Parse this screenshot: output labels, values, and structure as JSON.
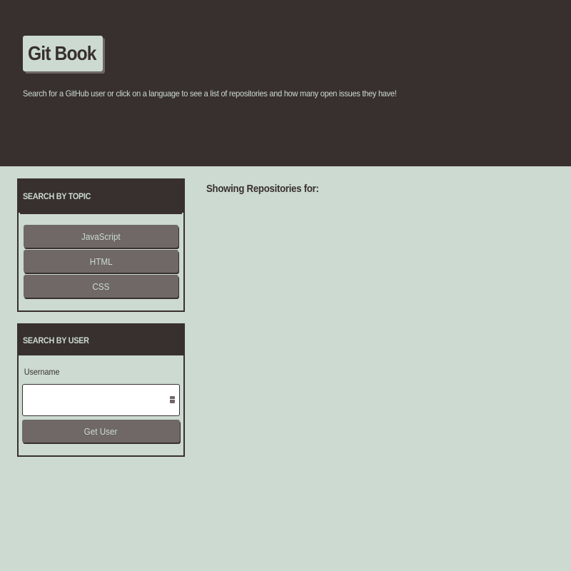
{
  "header": {
    "title": "Git Book",
    "subtitle": "Search for a GitHub user or click on a language to see a list of repositories and how many open issues they have!",
    "logo_icon": "github-icon"
  },
  "topic_search": {
    "title": "SEARCH BY TOPIC",
    "buttons": [
      "JavaScript",
      "HTML",
      "CSS"
    ]
  },
  "user_search": {
    "title": "SEARCH BY USER",
    "username_label": "Username",
    "username_value": "",
    "submit_label": "Get User"
  },
  "results": {
    "heading": "Showing Repositories for:"
  },
  "colors": {
    "dark": "#38302e",
    "light": "#ccdad1",
    "button": "#6f6866"
  }
}
